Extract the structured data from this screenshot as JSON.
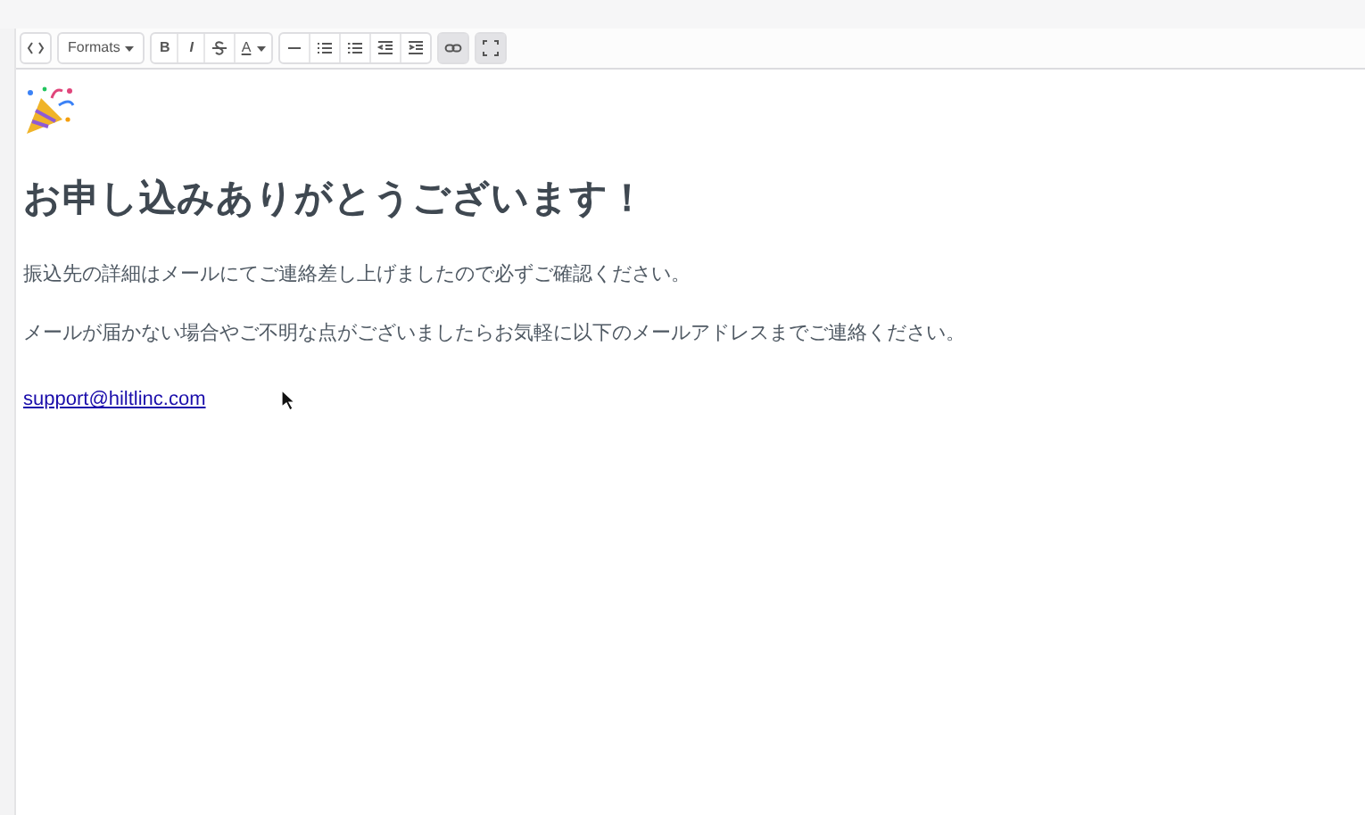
{
  "toolbar": {
    "groups": [
      {
        "buttons": [
          {
            "kind": "code",
            "active": false
          }
        ]
      },
      {
        "buttons": [
          {
            "kind": "dropdown",
            "label": "Formats",
            "active": false
          }
        ]
      },
      {
        "buttons": [
          {
            "kind": "bold",
            "label": "B",
            "active": false
          },
          {
            "kind": "italic",
            "label": "I",
            "active": false
          },
          {
            "kind": "strike",
            "active": false
          },
          {
            "kind": "color",
            "label": "A",
            "active": false
          }
        ]
      },
      {
        "buttons": [
          {
            "kind": "rule",
            "active": false
          },
          {
            "kind": "bullets",
            "active": false
          },
          {
            "kind": "numbers",
            "active": false
          },
          {
            "kind": "outdent",
            "active": false
          },
          {
            "kind": "indent",
            "active": false
          }
        ]
      },
      {
        "buttons": [
          {
            "kind": "link",
            "active": true
          }
        ]
      },
      {
        "buttons": [
          {
            "kind": "fullscreen",
            "active": true
          }
        ]
      }
    ]
  },
  "content": {
    "heading": "お申し込みありがとうございます！",
    "paragraphs": [
      "振込先の詳細はメールにてご連絡差し上げましたので必ずご確認ください。",
      "メールが届かない場合やご不明な点がございましたらお気軽に以下のメールアドレスまでご連絡ください。"
    ],
    "email": "support@hiltlinc.com"
  }
}
